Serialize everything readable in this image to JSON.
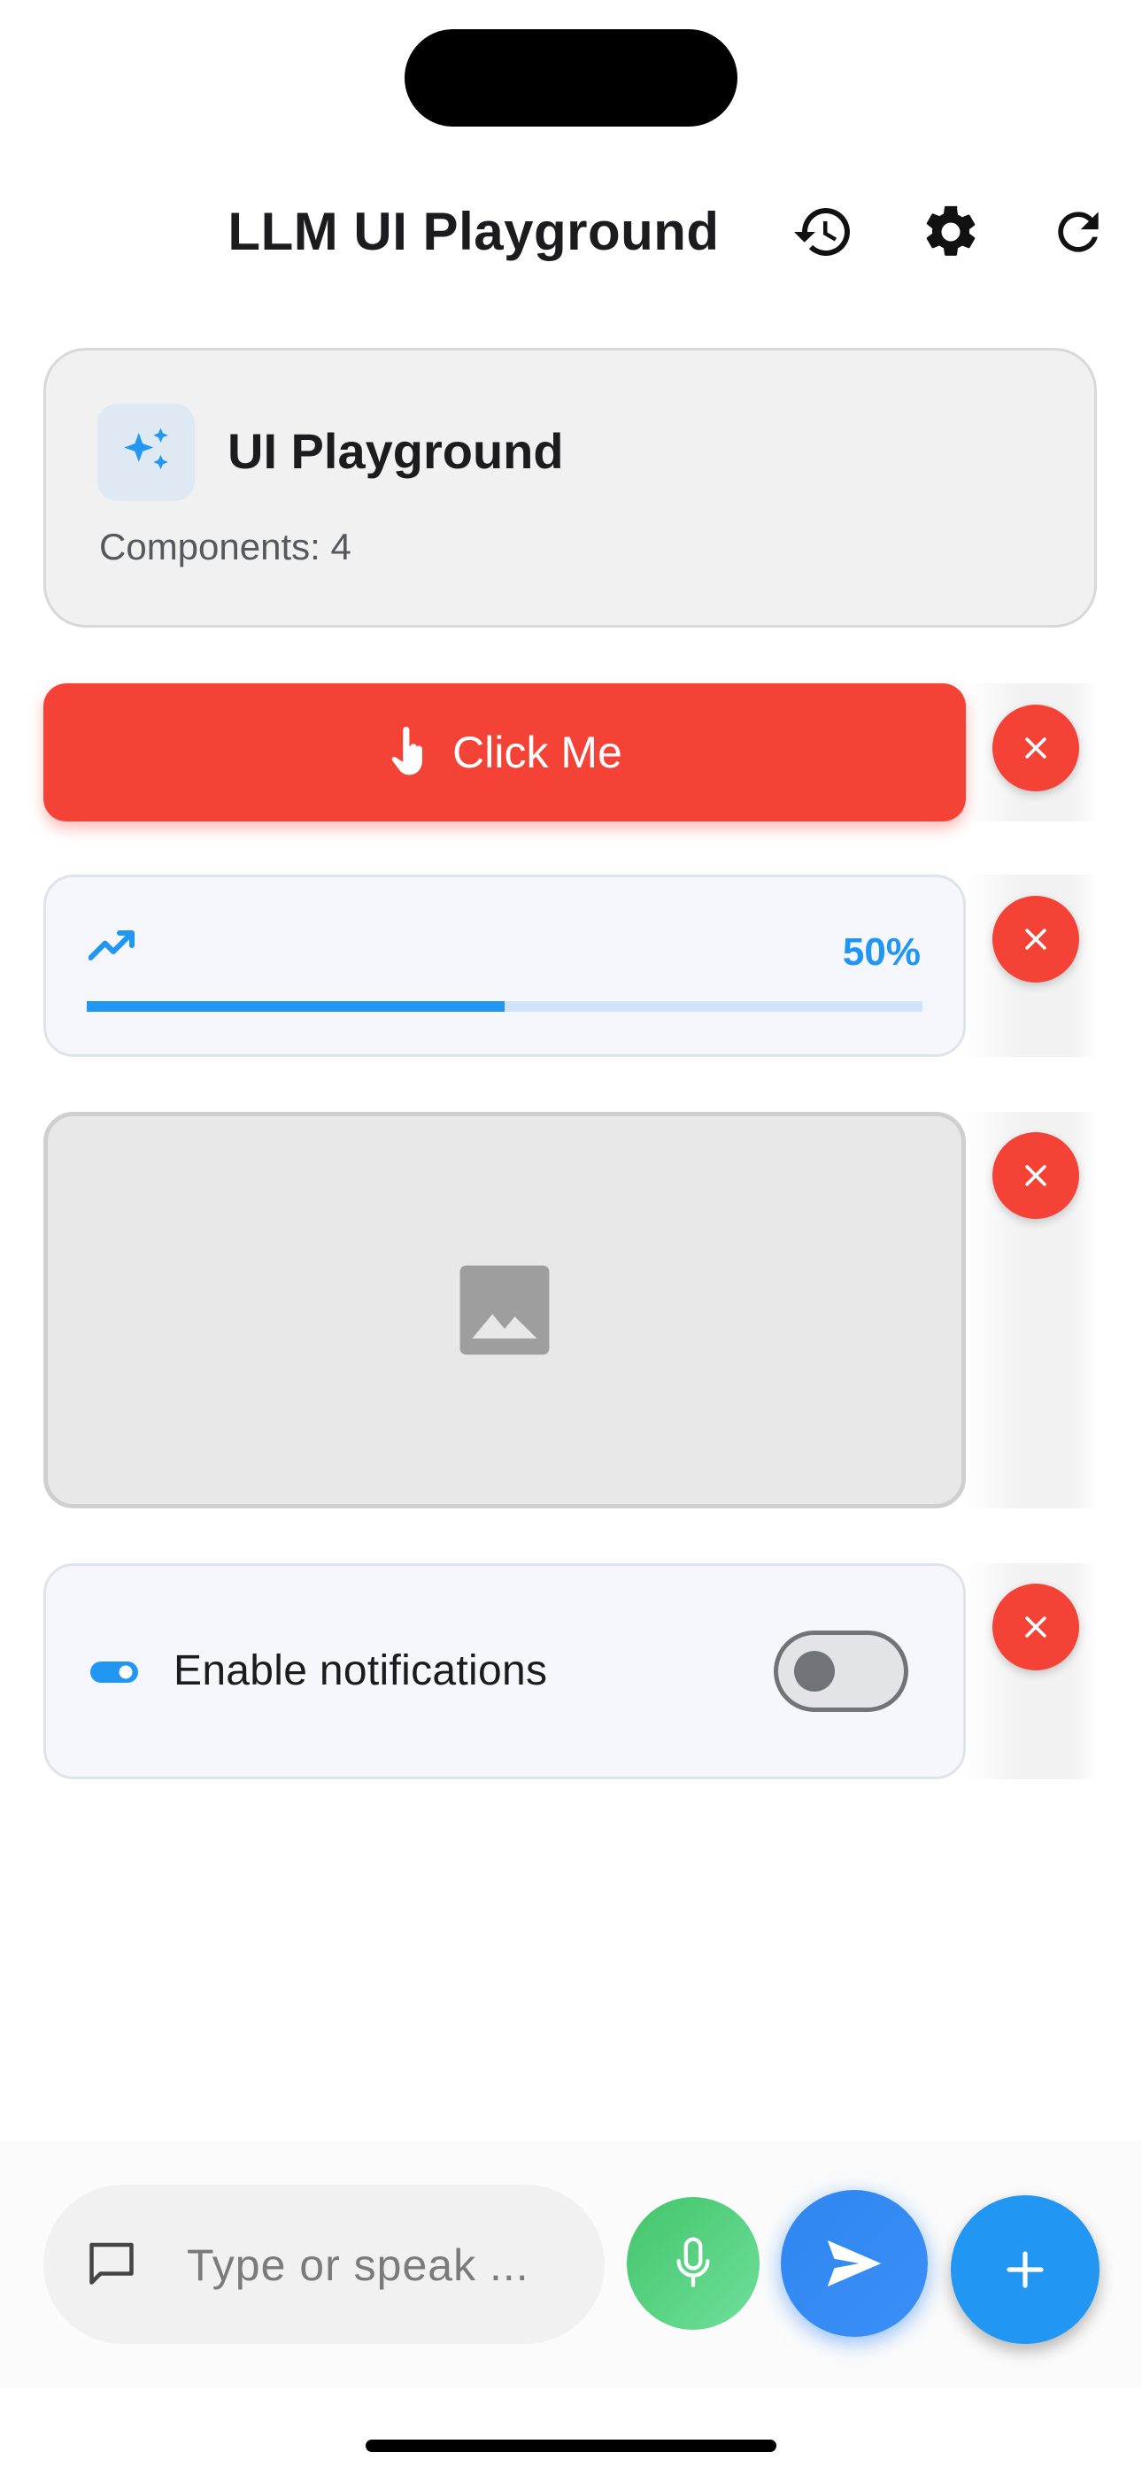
{
  "appbar": {
    "title": "LLM UI Playground",
    "actions": [
      "history-icon",
      "settings-icon",
      "refresh-icon"
    ]
  },
  "summary": {
    "title": "UI Playground",
    "components_label": "Components: 4",
    "icon": "sparkles-icon"
  },
  "components": {
    "button": {
      "label": "Click Me",
      "icon": "touch-icon",
      "color": "#f44336"
    },
    "progress": {
      "icon": "trending-up-icon",
      "value_label": "50%",
      "value": 0.5,
      "color": "#2196f3"
    },
    "image": {
      "icon": "image-placeholder-icon"
    },
    "toggle": {
      "label": "Enable notifications",
      "icon": "toggle-icon",
      "enabled": false
    }
  },
  "composer": {
    "placeholder": "Type or speak ...",
    "value": "",
    "icons": [
      "chat-bubble-icon",
      "microphone-icon",
      "send-icon",
      "plus-icon"
    ]
  },
  "colors": {
    "accent": "#2196f3",
    "danger": "#f44336",
    "mic": "#43c46b",
    "send": "#2f86f0"
  }
}
